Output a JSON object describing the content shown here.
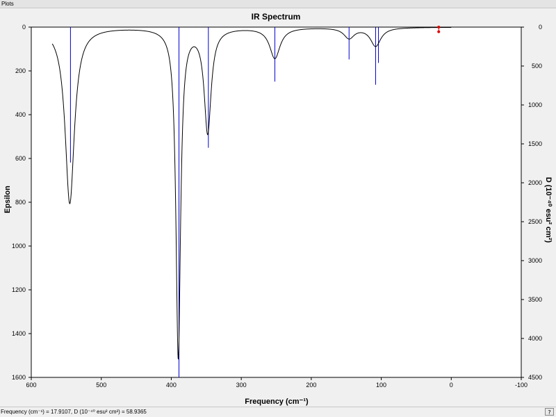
{
  "window": {
    "title": "Plots"
  },
  "status": {
    "text": "Frequency (cm⁻¹) = 17.9107, D (10⁻⁴⁰ esu² cm²) = 58.9365",
    "help_glyph": "?"
  },
  "chart_data": {
    "type": "line",
    "title": "IR Spectrum",
    "xlabel": "Frequency (cm⁻¹)",
    "ylabel": "Epsilon",
    "y2label": "D (10⁻⁴⁰ esu² cm²)",
    "xlim": [
      600,
      -100
    ],
    "ylim": [
      0,
      1600
    ],
    "y2lim": [
      0,
      4500
    ],
    "x_ticks": [
      "600",
      "500",
      "400",
      "300",
      "200",
      "100",
      "0",
      "-100"
    ],
    "y_ticks": [
      "0",
      "200",
      "400",
      "600",
      "800",
      "1000",
      "1200",
      "1400",
      "1600"
    ],
    "y2_ticks": [
      "0",
      "500",
      "1000",
      "1500",
      "2000",
      "2500",
      "3000",
      "3500",
      "4000",
      "4500"
    ],
    "spectrum_range": [
      570,
      0
    ],
    "peaks": [
      {
        "freq": 545,
        "epsilon": 805,
        "width": 8
      },
      {
        "freq": 390,
        "epsilon": 1505,
        "width": 4
      },
      {
        "freq": 348,
        "epsilon": 475,
        "width": 6
      },
      {
        "freq": 252,
        "epsilon": 140,
        "width": 9
      },
      {
        "freq": 146,
        "epsilon": 48,
        "width": 9
      },
      {
        "freq": 108,
        "epsilon": 85,
        "width": 9
      }
    ],
    "sticks": [
      {
        "freq": 544,
        "D": 1740
      },
      {
        "freq": 389,
        "D": 4500
      },
      {
        "freq": 347,
        "D": 1550
      },
      {
        "freq": 252,
        "D": 700
      },
      {
        "freq": 146,
        "D": 415
      },
      {
        "freq": 108,
        "D": 740
      },
      {
        "freq": 104,
        "D": 460
      }
    ],
    "cursor": {
      "freq": 17.9107,
      "D": 58.9365
    },
    "colors": {
      "curve": "#000000",
      "sticks": "#0000cc",
      "cursor": "#dd0000"
    }
  }
}
